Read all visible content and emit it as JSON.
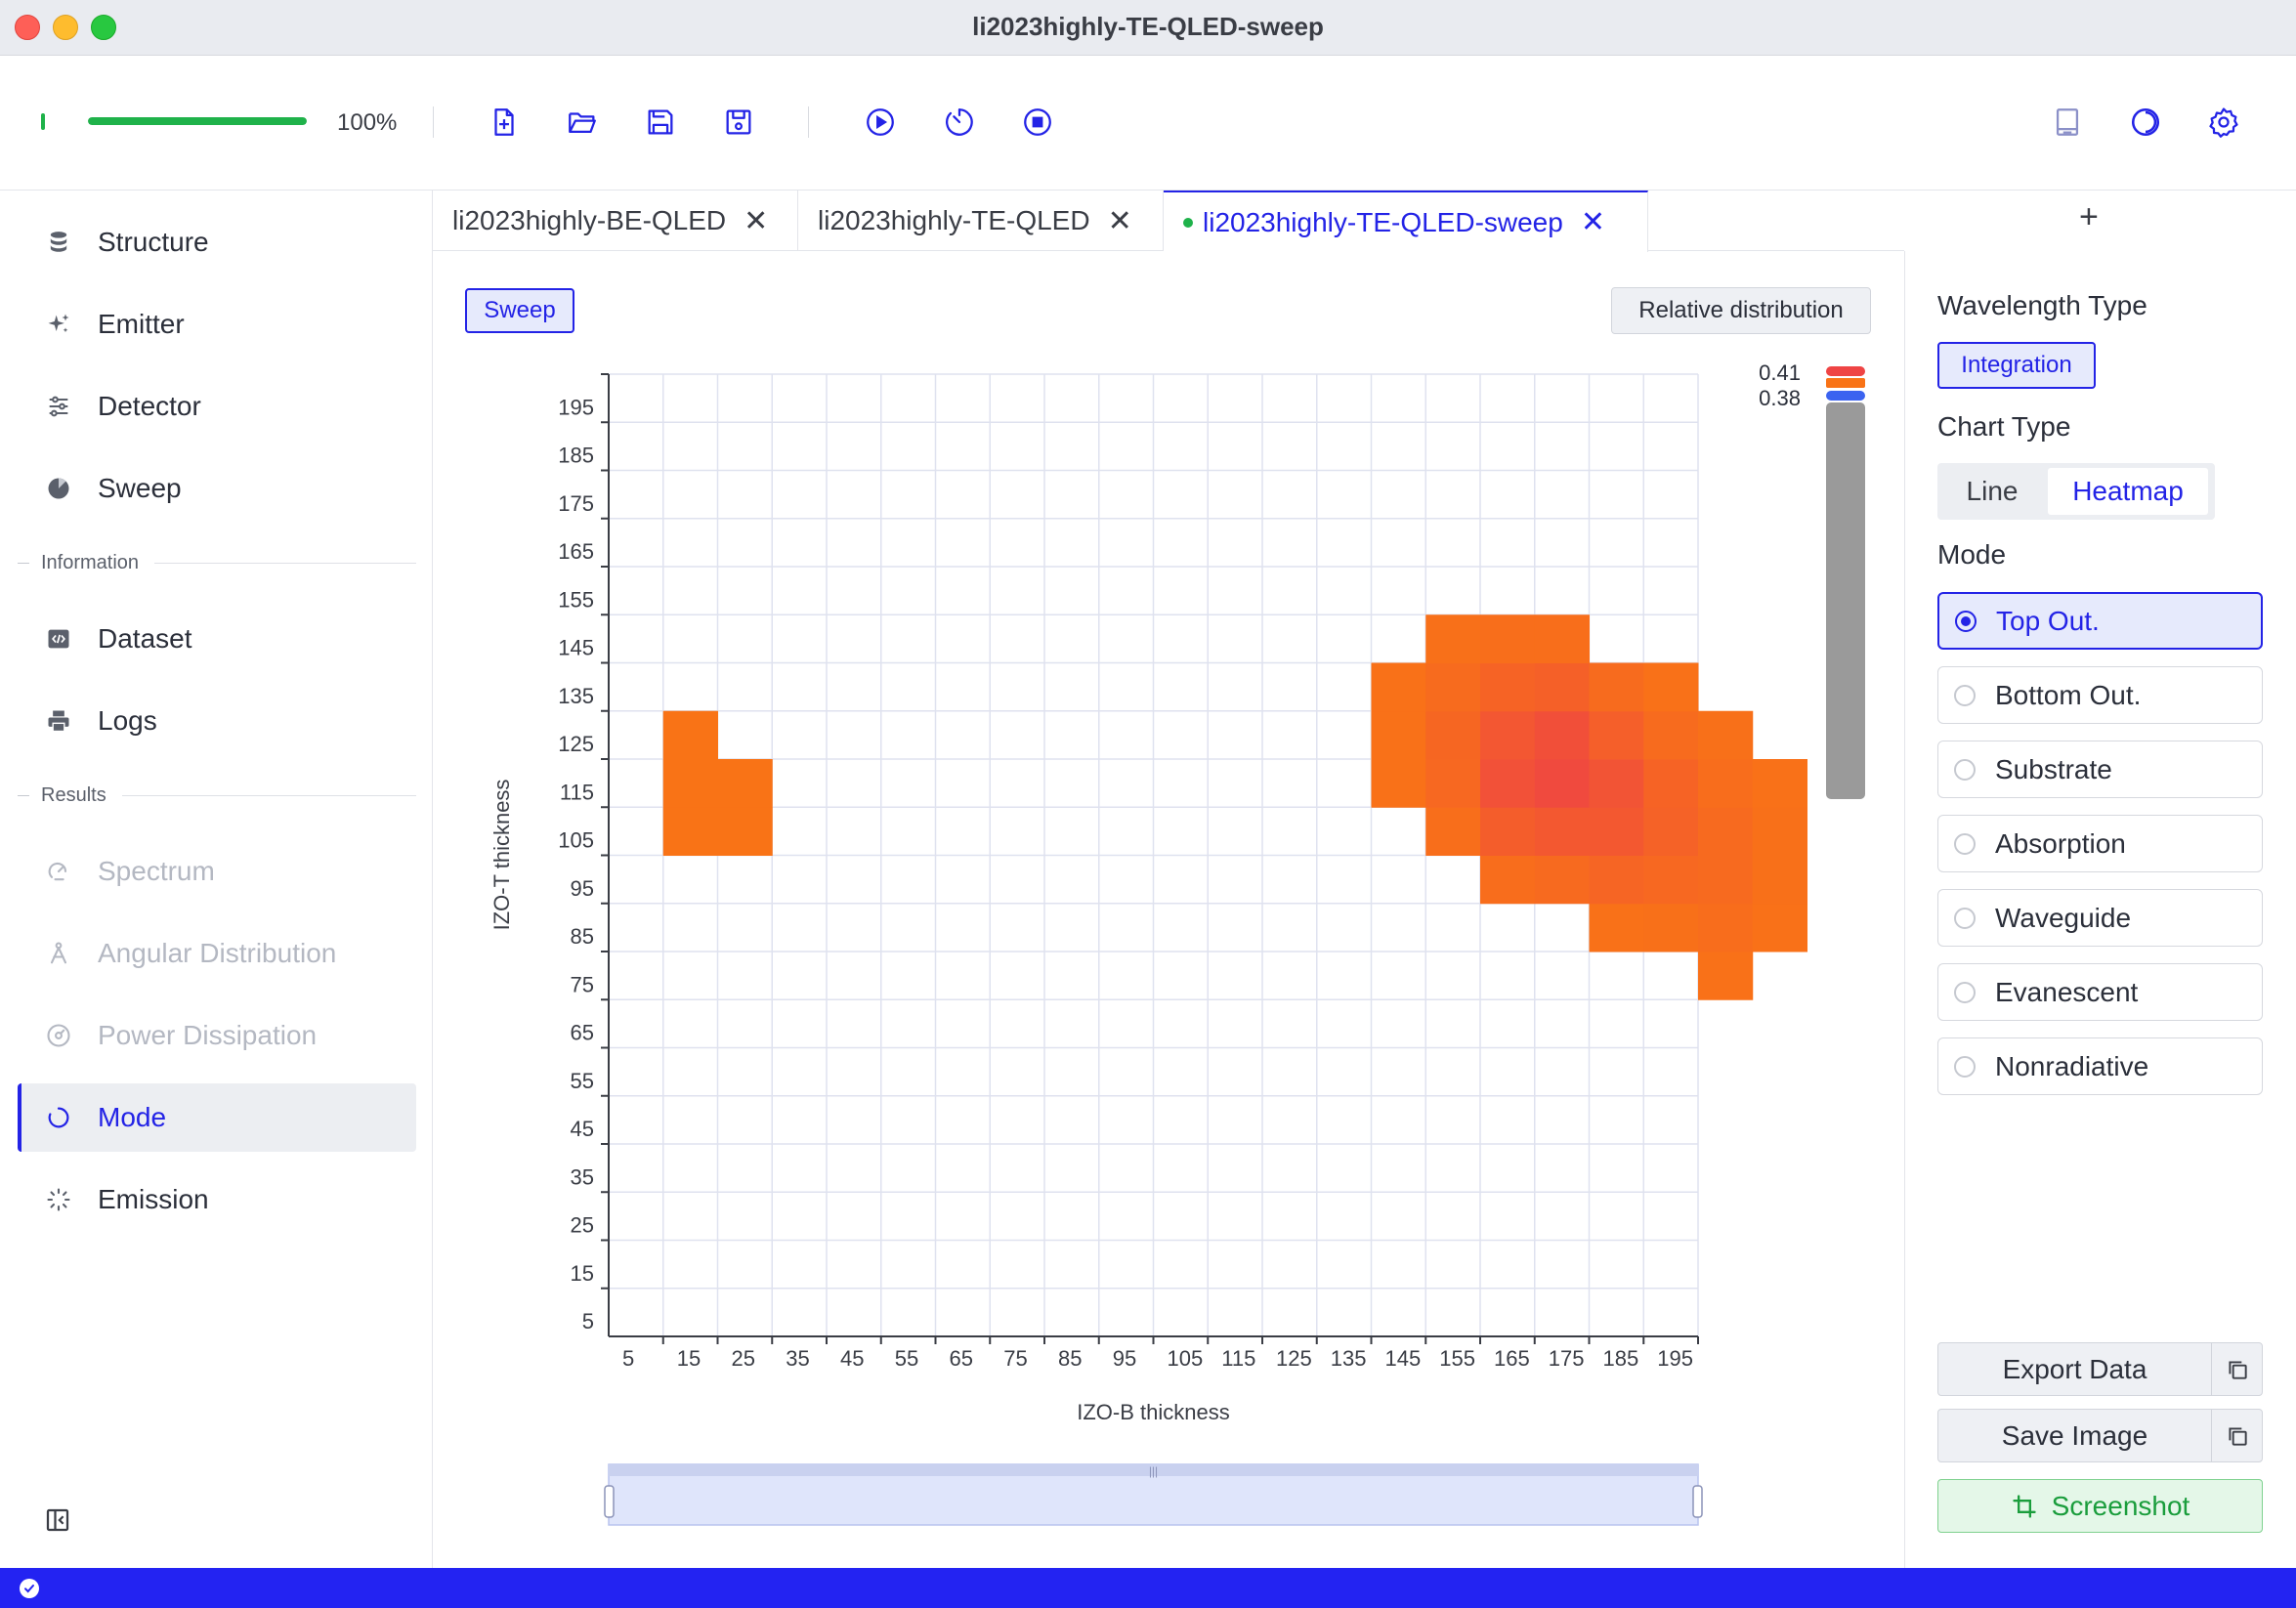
{
  "window": {
    "title": "li2023highly-TE-QLED-sweep"
  },
  "toolbar": {
    "progress": 1.0,
    "progress_label": "100%",
    "progress_color": "#1fb24a",
    "left_icons": [
      "new-file-icon",
      "open-folder-icon",
      "save-icon",
      "save-as-icon"
    ],
    "run_icons": [
      "play-icon",
      "timer-icon",
      "stop-icon"
    ],
    "right_icons": [
      "document-icon",
      "theme-icon",
      "settings-icon"
    ]
  },
  "sidebar": {
    "items": [
      {
        "id": "structure",
        "label": "Structure",
        "icon": "database-icon",
        "state": "normal"
      },
      {
        "id": "emitter",
        "label": "Emitter",
        "icon": "sparkle-icon",
        "state": "normal"
      },
      {
        "id": "detector",
        "label": "Detector",
        "icon": "sliders-icon",
        "state": "normal"
      },
      {
        "id": "sweep",
        "label": "Sweep",
        "icon": "pie-icon",
        "state": "normal"
      }
    ],
    "section_information": "Information",
    "info_items": [
      {
        "id": "dataset",
        "label": "Dataset",
        "icon": "code-icon",
        "state": "normal"
      },
      {
        "id": "logs",
        "label": "Logs",
        "icon": "printer-icon",
        "state": "normal"
      }
    ],
    "section_results": "Results",
    "result_items": [
      {
        "id": "spectrum",
        "label": "Spectrum",
        "icon": "spectrum-icon",
        "state": "disabled"
      },
      {
        "id": "angular",
        "label": "Angular Distribution",
        "icon": "angle-icon",
        "state": "disabled"
      },
      {
        "id": "power",
        "label": "Power Dissipation",
        "icon": "gauge-icon",
        "state": "disabled"
      },
      {
        "id": "mode",
        "label": "Mode",
        "icon": "loading-circle-icon",
        "state": "active"
      },
      {
        "id": "emission",
        "label": "Emission",
        "icon": "burst-icon",
        "state": "normal"
      }
    ]
  },
  "tabs": [
    {
      "label": "li2023highly-BE-QLED",
      "active": false
    },
    {
      "label": "li2023highly-TE-QLED",
      "active": false
    },
    {
      "label": "li2023highly-TE-QLED-sweep",
      "active": true
    }
  ],
  "tab_add_label": "+",
  "main": {
    "sweep_label": "Sweep",
    "relative_distribution_label": "Relative distribution"
  },
  "chart_data": {
    "type": "heatmap",
    "xlabel": "IZO-B thickness",
    "ylabel": "IZO-T thickness",
    "x_ticks": [
      5,
      15,
      25,
      35,
      45,
      55,
      65,
      75,
      85,
      95,
      105,
      115,
      125,
      135,
      145,
      155,
      165,
      175,
      185,
      195
    ],
    "y_ticks": [
      5,
      15,
      25,
      35,
      45,
      55,
      65,
      75,
      85,
      95,
      105,
      115,
      125,
      135,
      145,
      155,
      165,
      175,
      185,
      195
    ],
    "grid": true,
    "visual_map": {
      "min": 0.38,
      "max": 0.41,
      "min_label": "0.38",
      "max_label": "0.41",
      "low_color": "#f97316",
      "high_color": "#ef4444"
    },
    "cells": [
      {
        "x": 5,
        "y": 95,
        "v": 0.38
      },
      {
        "x": 5,
        "y": 105,
        "v": 0.38
      },
      {
        "x": 5,
        "y": 115,
        "v": 0.38
      },
      {
        "x": 15,
        "y": 95,
        "v": 0.38
      },
      {
        "x": 15,
        "y": 105,
        "v": 0.38
      },
      {
        "x": 135,
        "y": 105,
        "v": 0.381
      },
      {
        "x": 135,
        "y": 115,
        "v": 0.381
      },
      {
        "x": 135,
        "y": 125,
        "v": 0.381
      },
      {
        "x": 145,
        "y": 95,
        "v": 0.383
      },
      {
        "x": 145,
        "y": 105,
        "v": 0.387
      },
      {
        "x": 145,
        "y": 115,
        "v": 0.388
      },
      {
        "x": 145,
        "y": 125,
        "v": 0.385
      },
      {
        "x": 145,
        "y": 135,
        "v": 0.382
      },
      {
        "x": 155,
        "y": 85,
        "v": 0.384
      },
      {
        "x": 155,
        "y": 95,
        "v": 0.394
      },
      {
        "x": 155,
        "y": 105,
        "v": 0.402
      },
      {
        "x": 155,
        "y": 115,
        "v": 0.398
      },
      {
        "x": 155,
        "y": 125,
        "v": 0.39
      },
      {
        "x": 155,
        "y": 135,
        "v": 0.383
      },
      {
        "x": 165,
        "y": 85,
        "v": 0.386
      },
      {
        "x": 165,
        "y": 95,
        "v": 0.397
      },
      {
        "x": 165,
        "y": 105,
        "v": 0.406
      },
      {
        "x": 165,
        "y": 115,
        "v": 0.403
      },
      {
        "x": 165,
        "y": 125,
        "v": 0.392
      },
      {
        "x": 165,
        "y": 135,
        "v": 0.383
      },
      {
        "x": 175,
        "y": 75,
        "v": 0.381
      },
      {
        "x": 175,
        "y": 85,
        "v": 0.389
      },
      {
        "x": 175,
        "y": 95,
        "v": 0.397
      },
      {
        "x": 175,
        "y": 105,
        "v": 0.4
      },
      {
        "x": 175,
        "y": 115,
        "v": 0.393
      },
      {
        "x": 175,
        "y": 125,
        "v": 0.385
      },
      {
        "x": 185,
        "y": 75,
        "v": 0.382
      },
      {
        "x": 185,
        "y": 85,
        "v": 0.387
      },
      {
        "x": 185,
        "y": 95,
        "v": 0.391
      },
      {
        "x": 185,
        "y": 105,
        "v": 0.39
      },
      {
        "x": 185,
        "y": 115,
        "v": 0.385
      },
      {
        "x": 185,
        "y": 125,
        "v": 0.381
      },
      {
        "x": 195,
        "y": 65,
        "v": 0.381
      },
      {
        "x": 195,
        "y": 75,
        "v": 0.384
      },
      {
        "x": 195,
        "y": 85,
        "v": 0.386
      },
      {
        "x": 195,
        "y": 95,
        "v": 0.386
      },
      {
        "x": 195,
        "y": 105,
        "v": 0.384
      },
      {
        "x": 195,
        "y": 115,
        "v": 0.382
      },
      {
        "x": 205,
        "y": 75,
        "v": 0.381
      },
      {
        "x": 205,
        "y": 85,
        "v": 0.382
      },
      {
        "x": 205,
        "y": 95,
        "v": 0.382
      },
      {
        "x": 205,
        "y": 105,
        "v": 0.381
      }
    ]
  },
  "right_panel": {
    "wavelength_type_heading": "Wavelength Type",
    "integration_label": "Integration",
    "chart_type_heading": "Chart Type",
    "chart_type_options": [
      "Line",
      "Heatmap"
    ],
    "chart_type_selected": "Heatmap",
    "mode_heading": "Mode",
    "mode_options": [
      "Top Out.",
      "Bottom Out.",
      "Substrate",
      "Absorption",
      "Waveguide",
      "Evanescent",
      "Nonradiative"
    ],
    "mode_selected": "Top Out.",
    "export_label": "Export Data",
    "save_image_label": "Save Image",
    "screenshot_label": "Screenshot",
    "accent_color": "#2323e6",
    "success_color": "#1a9d3c"
  },
  "statusbar": {
    "color": "#2323f2",
    "icon": "check-circle-icon"
  }
}
